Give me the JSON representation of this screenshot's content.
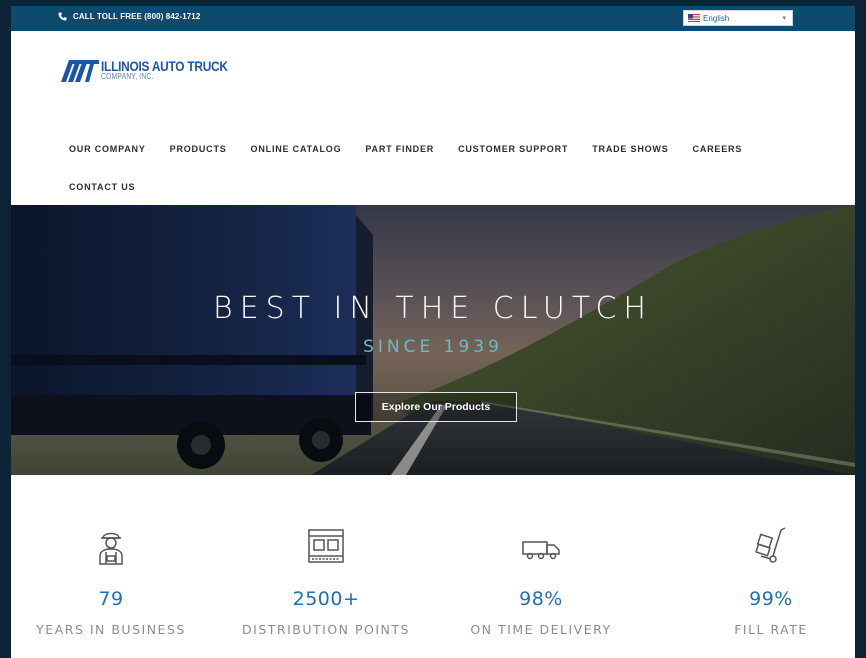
{
  "topbar": {
    "phone_label": "CALL TOLL FREE (800) 842-1712",
    "language_selected": "English"
  },
  "logo": {
    "line1": "ILLINOIS AUTO TRUCK",
    "line2": "COMPANY, INC."
  },
  "nav": {
    "items": [
      {
        "label": "OUR COMPANY"
      },
      {
        "label": "PRODUCTS"
      },
      {
        "label": "ONLINE CATALOG"
      },
      {
        "label": "PART FINDER"
      },
      {
        "label": "CUSTOMER SUPPORT"
      },
      {
        "label": "TRADE SHOWS"
      },
      {
        "label": "CAREERS"
      },
      {
        "label": "CONTACT US"
      }
    ]
  },
  "hero": {
    "title": "BEST IN THE CLUTCH",
    "subtitle": "SINCE 1939",
    "button_label": "Explore Our Products"
  },
  "stats": [
    {
      "icon": "worker-icon",
      "value": "79",
      "label": "YEARS IN BUSINESS"
    },
    {
      "icon": "warehouse-icon",
      "value": "2500+",
      "label": "DISTRIBUTION POINTS"
    },
    {
      "icon": "truck-icon",
      "value": "98%",
      "label": "ON TIME DELIVERY"
    },
    {
      "icon": "hand-truck-icon",
      "value": "99%",
      "label": "FILL RATE"
    }
  ],
  "colors": {
    "topbar": "#0e4a6e",
    "accent": "#1e6fb8",
    "hero_subtitle": "#6fb8c4",
    "page_border": "#0d2437"
  }
}
